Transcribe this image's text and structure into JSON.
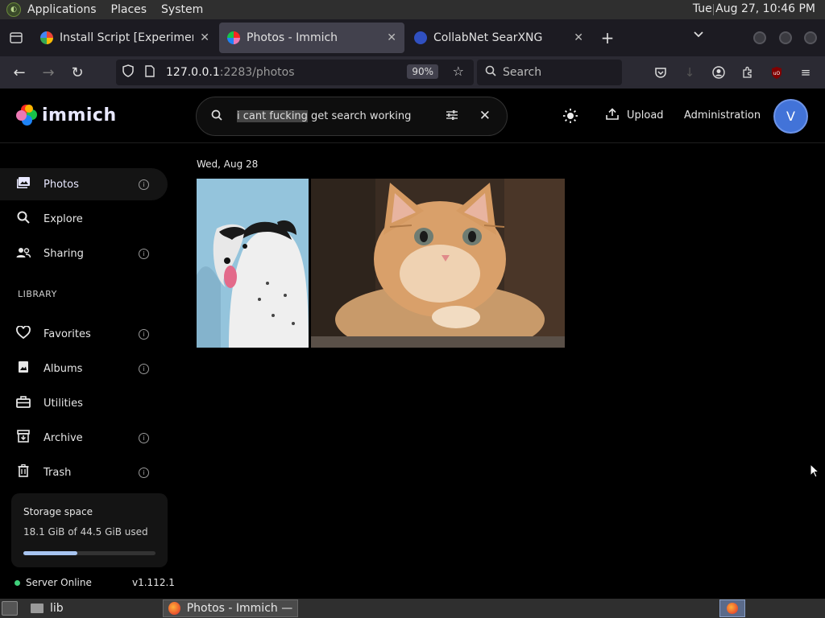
{
  "top_panel": {
    "menus": [
      "Applications",
      "Places",
      "System"
    ],
    "clock": "Tue Aug 27, 10:46 PM"
  },
  "browser": {
    "tabs": [
      {
        "title": "Install Script [Experimental]",
        "active": false
      },
      {
        "title": "Photos - Immich",
        "active": true
      },
      {
        "title": "CollabNet SearXNG",
        "active": false
      }
    ],
    "url_host": "127.0.0.1",
    "url_path": ":2283/photos",
    "zoom": "90%",
    "search_placeholder": "Search"
  },
  "app": {
    "brand": "immich",
    "search": {
      "query_selected": "i cant fucking",
      "query_rest": " get search working"
    },
    "upload_label": "Upload",
    "admin_label": "Administration",
    "avatar_initial": "V"
  },
  "sidebar": {
    "items": [
      {
        "label": "Photos",
        "icon": "photos-icon",
        "info": true
      },
      {
        "label": "Explore",
        "icon": "search-icon",
        "info": false
      },
      {
        "label": "Sharing",
        "icon": "people-icon",
        "info": true
      }
    ],
    "library_heading": "LIBRARY",
    "library_items": [
      {
        "label": "Favorites",
        "icon": "heart-icon",
        "info": true
      },
      {
        "label": "Albums",
        "icon": "album-icon",
        "info": true
      },
      {
        "label": "Utilities",
        "icon": "toolbox-icon",
        "info": false
      },
      {
        "label": "Archive",
        "icon": "archive-icon",
        "info": true
      },
      {
        "label": "Trash",
        "icon": "trash-icon",
        "info": true
      }
    ],
    "storage": {
      "title": "Storage space",
      "usage": "18.1 GiB of 44.5 GiB used",
      "fraction": 0.41
    },
    "server_status": "Server Online",
    "version": "v1.112.1"
  },
  "timeline": {
    "date_heading": "Wed, Aug 28"
  },
  "taskbar": {
    "folder_label": "lib",
    "task_title": "Photos - Immich — ..."
  }
}
